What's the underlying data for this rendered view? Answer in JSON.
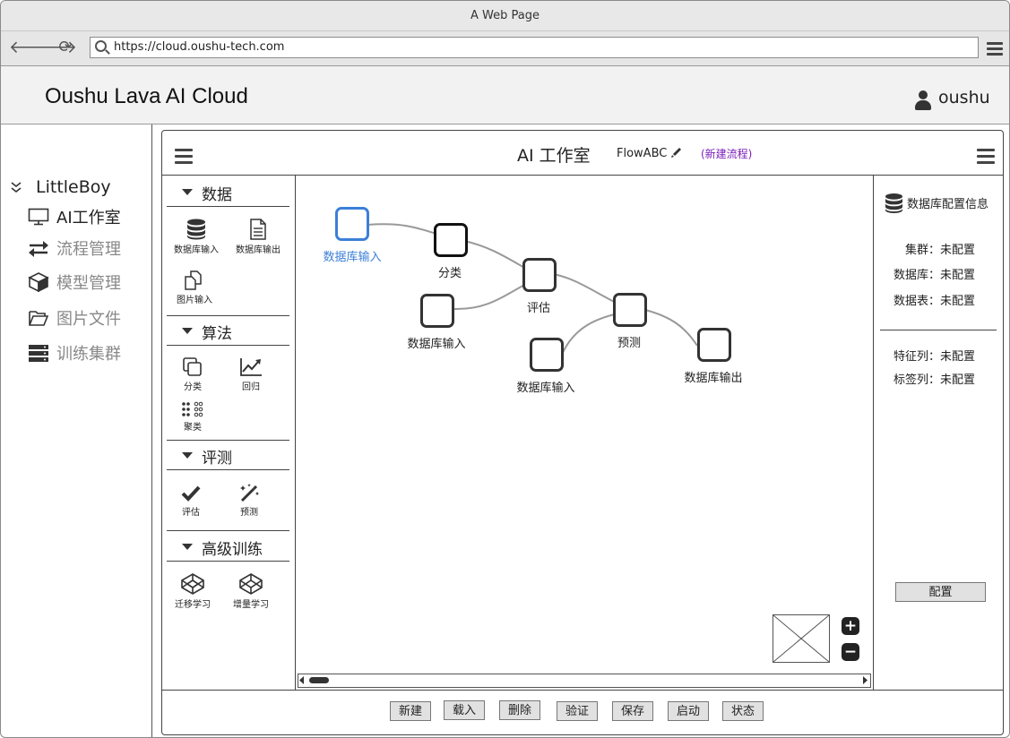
{
  "browser": {
    "window_title": "A Web Page",
    "url": "https://cloud.oushu-tech.com"
  },
  "app": {
    "title": "Oushu Lava AI Cloud",
    "user": "oushu"
  },
  "sidebar": {
    "root": "LittleBoy",
    "items": [
      {
        "label": "AI工作室",
        "icon": "monitor-icon",
        "active": true
      },
      {
        "label": "流程管理",
        "icon": "exchange-icon",
        "active": false
      },
      {
        "label": "模型管理",
        "icon": "cube-icon",
        "active": false
      },
      {
        "label": "图片文件",
        "icon": "folder-open-icon",
        "active": false
      },
      {
        "label": "训练集群",
        "icon": "server-icon",
        "active": false
      }
    ]
  },
  "studio": {
    "title": "AI 工作室",
    "flow_name": "FlowABC",
    "new_flow": "(新建流程)"
  },
  "palette": {
    "data": {
      "header": "数据",
      "tools": [
        {
          "label": "数据库输入",
          "icon": "database-icon"
        },
        {
          "label": "数据库输出",
          "icon": "file-text-icon"
        },
        {
          "label": "图片输入",
          "icon": "copy-icon"
        }
      ]
    },
    "algorithm": {
      "header": "算法",
      "tools": [
        {
          "label": "分类",
          "icon": "clone-icon"
        },
        {
          "label": "回归",
          "icon": "line-chart-icon"
        },
        {
          "label": "聚类",
          "icon": "dots-cluster-icon"
        }
      ]
    },
    "evaluation": {
      "header": "评测",
      "tools": [
        {
          "label": "评估",
          "icon": "check-icon"
        },
        {
          "label": "预测",
          "icon": "magic-wand-icon"
        }
      ]
    },
    "advanced": {
      "header": "高级训练",
      "tools": [
        {
          "label": "迁移学习",
          "icon": "codepen-icon"
        },
        {
          "label": "增量学习",
          "icon": "codepen-icon"
        }
      ]
    }
  },
  "canvas": {
    "nodes": [
      {
        "id": "n1",
        "label": "数据库输入",
        "selected": true
      },
      {
        "id": "n2",
        "label": "分类",
        "selected": false
      },
      {
        "id": "n3",
        "label": "数据库输入",
        "selected": false
      },
      {
        "id": "n4",
        "label": "评估",
        "selected": false
      },
      {
        "id": "n5",
        "label": "数据库输入",
        "selected": false
      },
      {
        "id": "n6",
        "label": "预测",
        "selected": false
      },
      {
        "id": "n7",
        "label": "数据库输出",
        "selected": false
      }
    ],
    "edges": [
      [
        "n1",
        "n2"
      ],
      [
        "n2",
        "n4"
      ],
      [
        "n3",
        "n4"
      ],
      [
        "n4",
        "n6"
      ],
      [
        "n5",
        "n6"
      ],
      [
        "n6",
        "n7"
      ]
    ],
    "zoom_in": "+",
    "zoom_out": "−"
  },
  "config": {
    "title": "数据库配置信息",
    "fields": [
      {
        "key": "集群：",
        "value": "未配置"
      },
      {
        "key": "数据库：",
        "value": "未配置"
      },
      {
        "key": "数据表：",
        "value": "未配置"
      }
    ],
    "fields2": [
      {
        "key": "特征列：",
        "value": "未配置"
      },
      {
        "key": "标签列：",
        "value": "未配置"
      }
    ],
    "button": "配置"
  },
  "actions": [
    "新建",
    "载入",
    "删除",
    "验证",
    "保存",
    "启动",
    "状态"
  ]
}
